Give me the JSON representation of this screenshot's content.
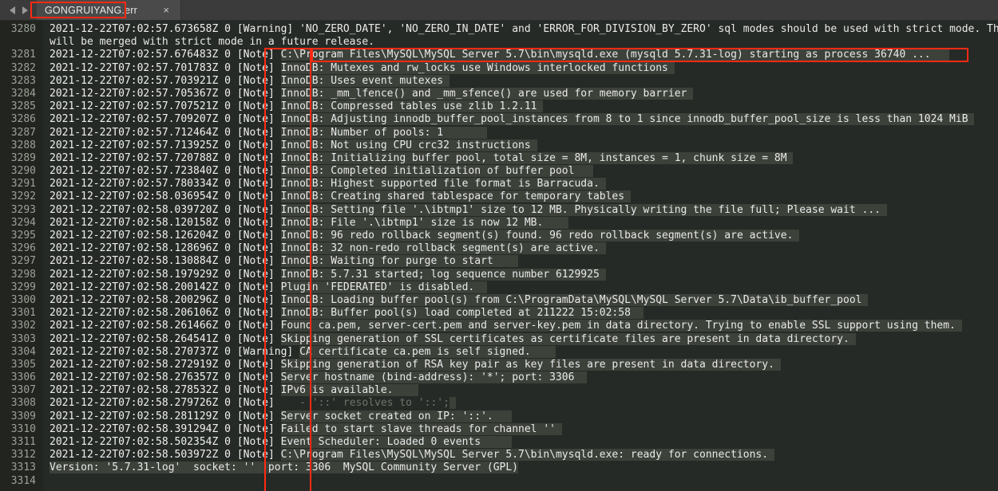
{
  "window": {
    "app": "text-editor",
    "tab_title": "GONGRUIYANG.err",
    "close_label": "×",
    "nav_back": "◀",
    "nav_forward": "▶"
  },
  "colors": {
    "background": "#262a26",
    "gutter_background": "#22251f",
    "tabbar_background": "#3b3b3b",
    "tab_active_background": "#4a4a4a",
    "text": "#e6e6e6",
    "line_number": "#9ba199",
    "selection_highlight": "#3c413a",
    "annotation_red": "#ff2a14"
  },
  "annotations": [
    {
      "name": "tab-title-box"
    },
    {
      "name": "note-column-box"
    },
    {
      "name": "startup-line-box"
    }
  ],
  "log": {
    "lines": [
      {
        "num": "3280",
        "ts": "2021-12-22T07:02:57.673658Z 0",
        "level": "[Warning]",
        "msg": "'NO_ZERO_DATE', 'NO_ZERO_IN_DATE' and 'ERROR_FOR_DIVISION_BY_ZERO' sql modes should be used with strict mode. They",
        "highlight": false
      },
      {
        "num": "",
        "ts": "",
        "level": "",
        "msg": "will be merged with strict mode in a future release.",
        "highlight": false,
        "wrap": true
      },
      {
        "num": "3281",
        "ts": "2021-12-22T07:02:57.676483Z 0",
        "level": "[Note]",
        "msg": "C:\\Program Files\\MySQL\\MySQL Server 5.7\\bin\\mysqld.exe (mysqld 5.7.31-log) starting as process 36740 ...",
        "highlight": true,
        "pad": 3
      },
      {
        "num": "3282",
        "ts": "2021-12-22T07:02:57.701783Z 0",
        "level": "[Note]",
        "msg": "InnoDB: Mutexes and rw_locks use Windows interlocked functions",
        "highlight": true,
        "pad": 1
      },
      {
        "num": "3283",
        "ts": "2021-12-22T07:02:57.703921Z 0",
        "level": "[Note]",
        "msg": "InnoDB: Uses event mutexes",
        "highlight": true,
        "pad": 1
      },
      {
        "num": "3284",
        "ts": "2021-12-22T07:02:57.705367Z 0",
        "level": "[Note]",
        "msg": "InnoDB: _mm_lfence() and _mm_sfence() are used for memory barrier",
        "highlight": true,
        "pad": 1
      },
      {
        "num": "3285",
        "ts": "2021-12-22T07:02:57.707521Z 0",
        "level": "[Note]",
        "msg": "InnoDB: Compressed tables use zlib 1.2.11",
        "highlight": true,
        "pad": 1
      },
      {
        "num": "3286",
        "ts": "2021-12-22T07:02:57.709207Z 0",
        "level": "[Note]",
        "msg": "InnoDB: Adjusting innodb_buffer_pool_instances from 8 to 1 since innodb_buffer_pool_size is less than 1024 MiB",
        "highlight": true,
        "pad": 1
      },
      {
        "num": "3287",
        "ts": "2021-12-22T07:02:57.712464Z 0",
        "level": "[Note]",
        "msg": "InnoDB: Number of pools: 1",
        "highlight": true,
        "pad": 7
      },
      {
        "num": "3288",
        "ts": "2021-12-22T07:02:57.713925Z 0",
        "level": "[Note]",
        "msg": "InnoDB: Not using CPU crc32 instructions",
        "highlight": true,
        "pad": 1
      },
      {
        "num": "3289",
        "ts": "2021-12-22T07:02:57.720788Z 0",
        "level": "[Note]",
        "msg": "InnoDB: Initializing buffer pool, total size = 8M, instances = 1, chunk size = 8M",
        "highlight": true,
        "pad": 1
      },
      {
        "num": "3290",
        "ts": "2021-12-22T07:02:57.723840Z 0",
        "level": "[Note]",
        "msg": "InnoDB: Completed initialization of buffer pool",
        "highlight": true,
        "pad": 3
      },
      {
        "num": "3291",
        "ts": "2021-12-22T07:02:57.780334Z 0",
        "level": "[Note]",
        "msg": "InnoDB: Highest supported file format is Barracuda.",
        "highlight": true,
        "pad": 1
      },
      {
        "num": "3292",
        "ts": "2021-12-22T07:02:58.036954Z 0",
        "level": "[Note]",
        "msg": "InnoDB: Creating shared tablespace for temporary tables",
        "highlight": true,
        "pad": 1
      },
      {
        "num": "3293",
        "ts": "2021-12-22T07:02:58.039720Z 0",
        "level": "[Note]",
        "msg": "InnoDB: Setting file '.\\ibtmp1' size to 12 MB. Physically writing the file full; Please wait ...",
        "highlight": true,
        "pad": 1
      },
      {
        "num": "3294",
        "ts": "2021-12-22T07:02:58.120158Z 0",
        "level": "[Note]",
        "msg": "InnoDB: File '.\\ibtmp1' size is now 12 MB.",
        "highlight": true,
        "pad": 4
      },
      {
        "num": "3295",
        "ts": "2021-12-22T07:02:58.126204Z 0",
        "level": "[Note]",
        "msg": "InnoDB: 96 redo rollback segment(s) found. 96 redo rollback segment(s) are active.",
        "highlight": true,
        "pad": 1
      },
      {
        "num": "3296",
        "ts": "2021-12-22T07:02:58.128696Z 0",
        "level": "[Note]",
        "msg": "InnoDB: 32 non-redo rollback segment(s) are active.",
        "highlight": true,
        "pad": 1
      },
      {
        "num": "3297",
        "ts": "2021-12-22T07:02:58.130884Z 0",
        "level": "[Note]",
        "msg": "InnoDB: Waiting for purge to start",
        "highlight": true,
        "pad": 4
      },
      {
        "num": "3298",
        "ts": "2021-12-22T07:02:58.197929Z 0",
        "level": "[Note]",
        "msg": "InnoDB: 5.7.31 started; log sequence number 6129925",
        "highlight": true,
        "pad": 1
      },
      {
        "num": "3299",
        "ts": "2021-12-22T07:02:58.200142Z 0",
        "level": "[Note]",
        "msg": "Plugin 'FEDERATED' is disabled.",
        "highlight": true,
        "pad": 2
      },
      {
        "num": "3300",
        "ts": "2021-12-22T07:02:58.200296Z 0",
        "level": "[Note]",
        "msg": "InnoDB: Loading buffer pool(s) from C:\\ProgramData\\MySQL\\MySQL Server 5.7\\Data\\ib_buffer_pool",
        "highlight": true,
        "pad": 1
      },
      {
        "num": "3301",
        "ts": "2021-12-22T07:02:58.206106Z 0",
        "level": "[Note]",
        "msg": "InnoDB: Buffer pool(s) load completed at 211222 15:02:58",
        "highlight": true,
        "pad": 2
      },
      {
        "num": "3302",
        "ts": "2021-12-22T07:02:58.261466Z 0",
        "level": "[Note]",
        "msg": "Found ca.pem, server-cert.pem and server-key.pem in data directory. Trying to enable SSL support using them.",
        "highlight": true,
        "pad": 1
      },
      {
        "num": "3303",
        "ts": "2021-12-22T07:02:58.264541Z 0",
        "level": "[Note]",
        "msg": "Skipping generation of SSL certificates as certificate files are present in data directory.",
        "highlight": true,
        "pad": 1
      },
      {
        "num": "3304",
        "ts": "2021-12-22T07:02:58.270737Z 0",
        "level": "[Warning]",
        "msg": "CA certificate ca.pem is self signed.",
        "highlight": true,
        "pad": 4
      },
      {
        "num": "3305",
        "ts": "2021-12-22T07:02:58.272919Z 0",
        "level": "[Note]",
        "msg": "Skipping generation of RSA key pair as key files are present in data directory.",
        "highlight": true,
        "pad": 1
      },
      {
        "num": "3306",
        "ts": "2021-12-22T07:02:58.276357Z 0",
        "level": "[Note]",
        "msg": "Server hostname (bind-address): '*'; port: 3306",
        "highlight": true,
        "pad": 2
      },
      {
        "num": "3307",
        "ts": "2021-12-22T07:02:58.278532Z 0",
        "level": "[Note]",
        "msg": "IPv6 is available.",
        "highlight": true,
        "pad": 4
      },
      {
        "num": "3308",
        "ts": "2021-12-22T07:02:58.279726Z 0",
        "level": "[Note]",
        "msg": "   - '::' resolves to '::';",
        "highlight": true,
        "dim": true,
        "pad": 1
      },
      {
        "num": "3309",
        "ts": "2021-12-22T07:02:58.281129Z 0",
        "level": "[Note]",
        "msg": "Server socket created on IP: '::'.",
        "highlight": true,
        "pad": 3
      },
      {
        "num": "3310",
        "ts": "2021-12-22T07:02:58.391294Z 0",
        "level": "[Note]",
        "msg": "Failed to start slave threads for channel ''",
        "highlight": true,
        "pad": 1
      },
      {
        "num": "3311",
        "ts": "2021-12-22T07:02:58.502354Z 0",
        "level": "[Note]",
        "msg": "Event Scheduler: Loaded 0 events",
        "highlight": true,
        "pad": 5
      },
      {
        "num": "3312",
        "ts": "2021-12-22T07:02:58.503972Z 0",
        "level": "[Note]",
        "msg": "C:\\Program Files\\MySQL\\MySQL Server 5.7\\bin\\mysqld.exe: ready for connections.",
        "highlight": true,
        "pad": 1
      },
      {
        "num": "3313",
        "ts": "",
        "level": "",
        "msg": "Version: '5.7.31-log'  socket: ''  port: 3306  MySQL Community Server (GPL)",
        "highlight": true,
        "wrap": true,
        "pad": 0
      },
      {
        "num": "3314",
        "ts": "",
        "level": "",
        "msg": "",
        "highlight": false,
        "wrap": true
      }
    ]
  }
}
